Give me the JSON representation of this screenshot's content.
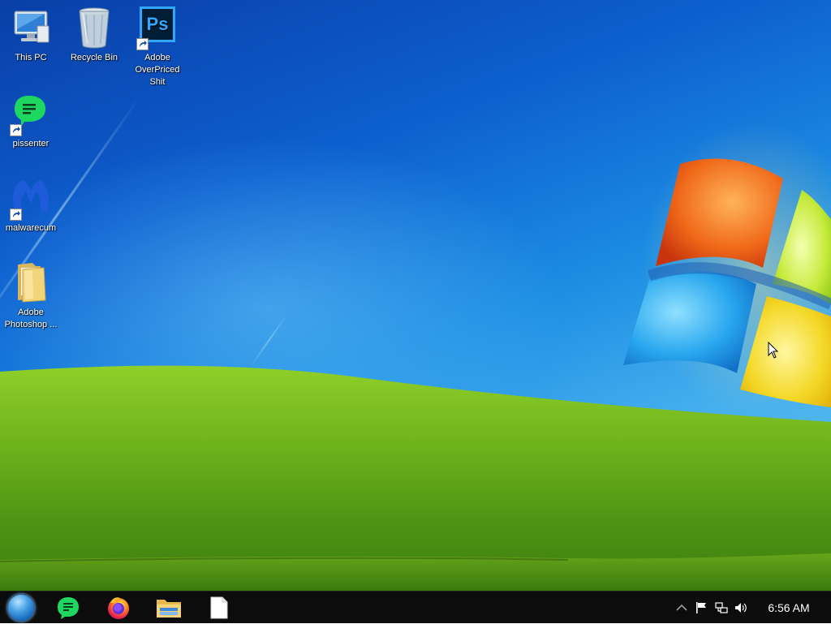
{
  "desktop": {
    "icons": [
      {
        "label": "This PC"
      },
      {
        "label": "Recycle Bin"
      },
      {
        "label": "Adobe OverPriced Shit",
        "glyph_text": "Ps"
      },
      {
        "label": "pissenter"
      },
      {
        "label": "malwarecum"
      },
      {
        "label": "Adobe Photoshop ..."
      }
    ]
  },
  "taskbar": {
    "pinned": [
      {
        "icon": "start-orb"
      },
      {
        "icon": "chat-app-icon"
      },
      {
        "icon": "firefox-icon"
      },
      {
        "icon": "file-explorer-icon"
      },
      {
        "icon": "blank-document-icon"
      }
    ],
    "tray": {
      "icons": [
        "chevron-up-icon",
        "flag-icon",
        "network-icon",
        "volume-icon"
      ],
      "clock": "6:56 AM"
    }
  },
  "colors": {
    "taskbar_bg": "#0c0c0c",
    "accent_green": "#1ed760",
    "photoshop_bg": "#001e36",
    "photoshop_fg": "#31a8ff"
  }
}
